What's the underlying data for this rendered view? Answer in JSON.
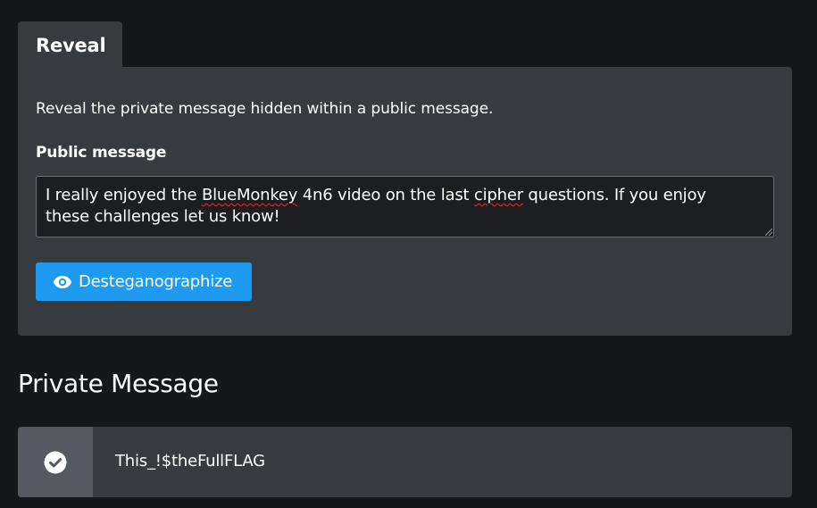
{
  "reveal_tab": {
    "label": "Reveal"
  },
  "panel": {
    "description": "Reveal the private message hidden within a public message.",
    "field_label": "Public message",
    "textarea": {
      "segments": [
        "I really enjoyed the ",
        "BlueMonkey",
        " 4n6 video on the last ",
        "cipher",
        " questions. If you enjoy",
        "these challenges let us know!"
      ],
      "spellcheck_flagged": [
        "BlueMonkey",
        "cipher"
      ]
    },
    "button": {
      "label": "Desteganographize",
      "icon": "eye-icon",
      "color": "#1e9bf0"
    }
  },
  "private_section": {
    "title": "Private Message",
    "result": {
      "icon": "check-circle-icon",
      "text": "This_!$theFullFLAG"
    }
  },
  "colors": {
    "background": "#15171b",
    "panel": "#373a3f",
    "textarea_bg": "#1c1e22",
    "accent": "#1e9bf0",
    "result_icon_bg": "#565a60"
  }
}
